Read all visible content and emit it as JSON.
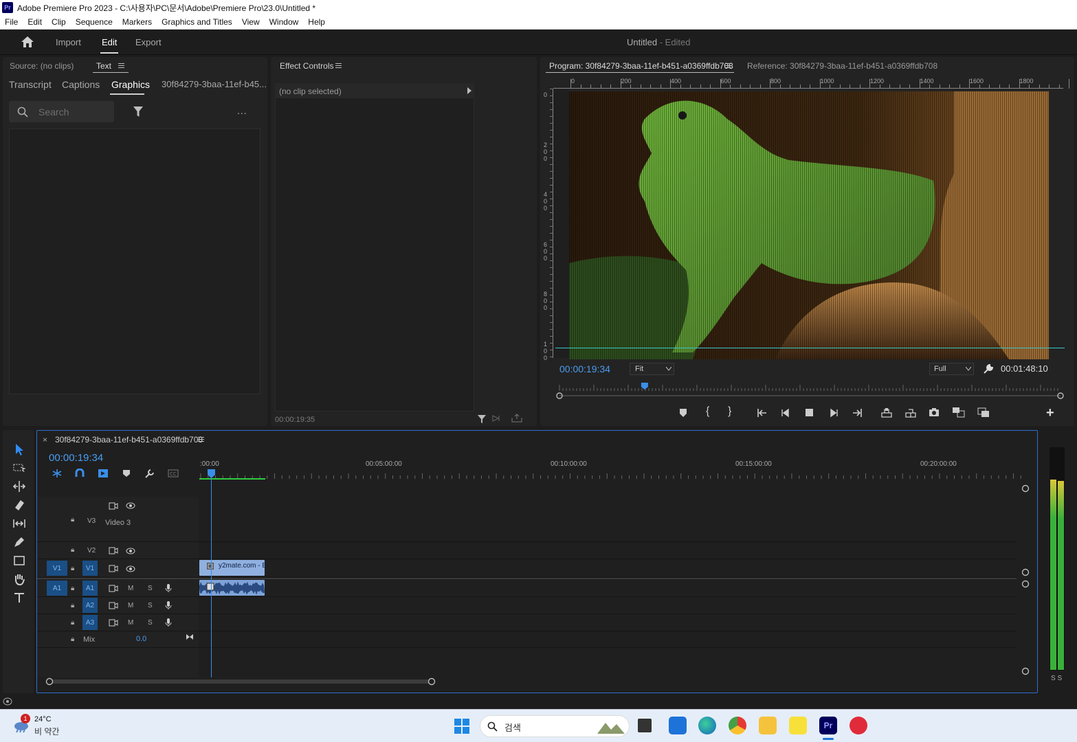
{
  "window": {
    "title": "Adobe Premiere Pro 2023 - C:\\사용자\\PC\\문서\\Adobe\\Premiere Pro\\23.0\\Untitled *",
    "app_badge": "Pr"
  },
  "menu": [
    "File",
    "Edit",
    "Clip",
    "Sequence",
    "Markers",
    "Graphics and Titles",
    "View",
    "Window",
    "Help"
  ],
  "workspace": {
    "tabs": [
      "Import",
      "Edit",
      "Export"
    ],
    "active_tab": "Edit",
    "project_title": "Untitled",
    "edited_suffix": "- Edited"
  },
  "source_panel": {
    "tabs": [
      "Source: (no clips)",
      "Text"
    ],
    "sub_tabs": [
      "Transcript",
      "Captions",
      "Graphics",
      "30f84279-3baa-11ef-b45..."
    ],
    "active_sub_tab": "Graphics",
    "search_placeholder": "Search",
    "more_label": "..."
  },
  "effect_controls": {
    "title": "Effect Controls",
    "no_clip": "(no clip selected)",
    "timecode": "00:00:19:35"
  },
  "program_monitor": {
    "program_tab": "Program: 30f84279-3baa-11ef-b451-a0369ffdb708",
    "reference_tab": "Reference: 30f84279-3baa-11ef-b451-a0369ffdb708",
    "ruler_h_labels": [
      "0",
      "200",
      "400",
      "600",
      "800",
      "1000",
      "1200",
      "1400",
      "1600",
      "1800"
    ],
    "ruler_v_labels": [
      "0",
      "2\n0\n0",
      "4\n0\n0",
      "6\n0\n0",
      "8\n0\n0",
      "1\n0\n0"
    ],
    "current_timecode": "00:00:19:34",
    "fit_option": "Fit",
    "resolution_option": "Full",
    "duration": "00:01:48:10",
    "playhead_fraction": 0.17
  },
  "timeline": {
    "sequence_name": "30f84279-3baa-11ef-b451-a0369ffdb708",
    "close_label": "×",
    "timecode": "00:00:19:34",
    "time_labels": [
      ":00:00",
      "00:05:00:00",
      "00:10:00:00",
      "00:15:00:00",
      "00:20:00:00"
    ],
    "tracks": [
      {
        "id": "V3",
        "name": "Video 3",
        "src": ""
      },
      {
        "id": "V2",
        "name": "",
        "src": ""
      },
      {
        "id": "V1",
        "name": "",
        "src": "V1"
      },
      {
        "id": "A1",
        "name": "",
        "src": "A1"
      },
      {
        "id": "A2",
        "name": "",
        "src": ""
      },
      {
        "id": "A3",
        "name": "",
        "src": ""
      }
    ],
    "audio_buttons": {
      "m": "M",
      "s": "S"
    },
    "mix_label": "Mix",
    "mix_value": "0.0",
    "clip_label": "y2mate.com - B"
  },
  "meter": {
    "solo_labels": "S S"
  },
  "taskbar": {
    "weather_temp": "24°C",
    "weather_desc": "비 약간",
    "notification_count": "1",
    "search_placeholder": "검색"
  }
}
